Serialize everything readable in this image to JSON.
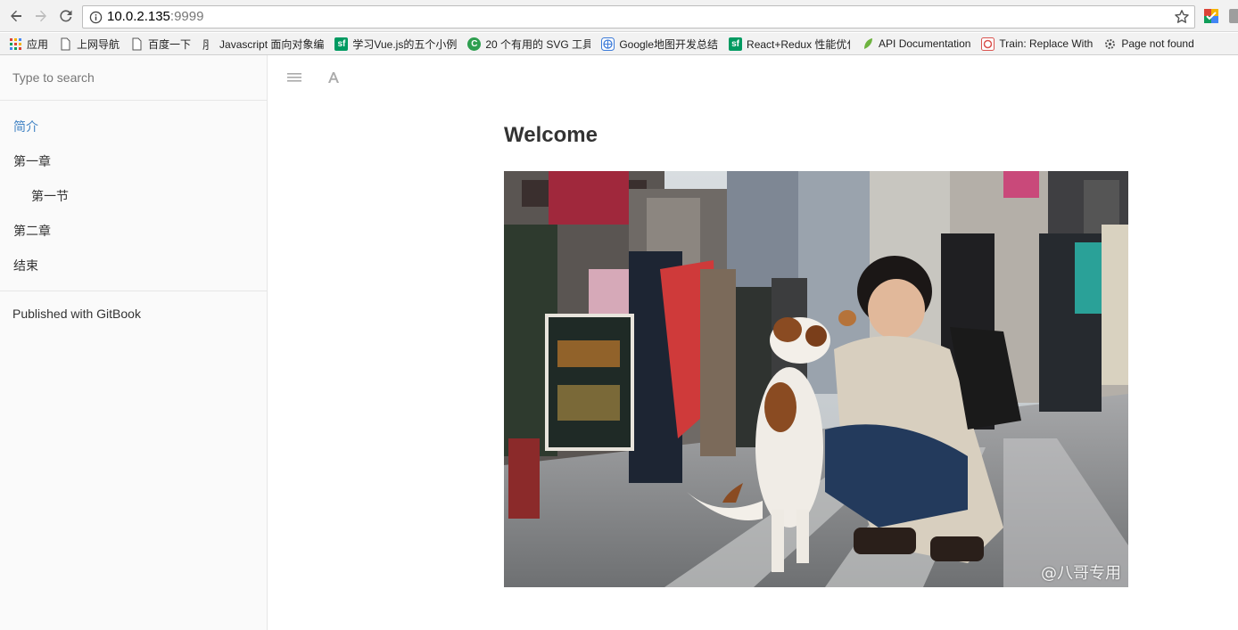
{
  "browser": {
    "url_host": "10.0.2.135",
    "url_port": ":9999",
    "bookmarks": [
      {
        "label": "应用",
        "icon": "apps-grid-icon"
      },
      {
        "label": "上网导航",
        "icon": "page-icon"
      },
      {
        "label": "百度一下",
        "icon": "page-icon"
      },
      {
        "label": "Javascript 面向对象编",
        "icon": "js-icon"
      },
      {
        "label": "学习Vue.js的五个小例",
        "icon": "sf-icon"
      },
      {
        "label": "20 个有用的 SVG 工具",
        "icon": "c-icon"
      },
      {
        "label": "Google地图开发总结",
        "icon": "globe-icon"
      },
      {
        "label": "React+Redux 性能优化",
        "icon": "sf-icon"
      },
      {
        "label": "API Documentation",
        "icon": "leaf-icon"
      },
      {
        "label": "Train: Replace With",
        "icon": "spiral-icon"
      },
      {
        "label": "Page not found",
        "icon": "gear-icon"
      }
    ]
  },
  "sidebar": {
    "search_placeholder": "Type to search",
    "items": [
      {
        "label": "简介"
      },
      {
        "label": "第一章"
      },
      {
        "label": "第一节"
      },
      {
        "label": "第二章"
      },
      {
        "label": "结束"
      }
    ],
    "published": "Published with GitBook"
  },
  "page": {
    "title": "Welcome",
    "image_watermark": "@八哥专用"
  },
  "colors": {
    "active_link": "#4183c4",
    "text": "#333333",
    "sidebar_bg": "#fafafa"
  }
}
